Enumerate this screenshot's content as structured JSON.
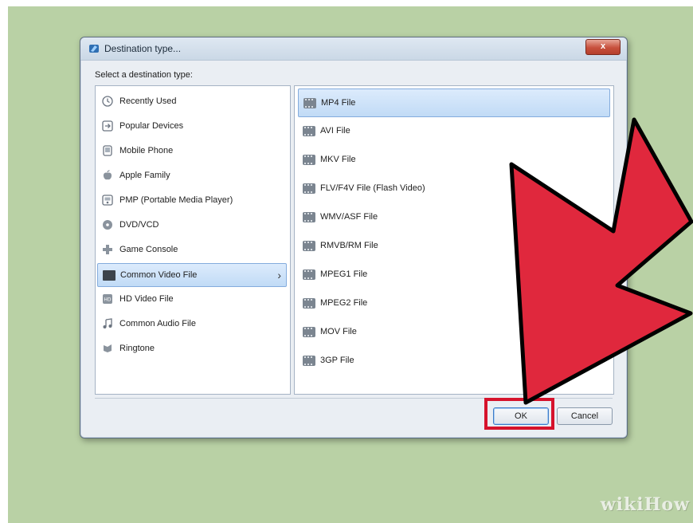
{
  "dialog": {
    "title": "Destination type...",
    "close_glyph": "x",
    "prompt": "Select a destination type:"
  },
  "categories": [
    {
      "label": "Recently Used",
      "icon": "clock-icon"
    },
    {
      "label": "Popular Devices",
      "icon": "arrow-box-icon"
    },
    {
      "label": "Mobile Phone",
      "icon": "phone-icon"
    },
    {
      "label": "Apple Family",
      "icon": "apple-icon"
    },
    {
      "label": "PMP (Portable Media Player)",
      "icon": "media-player-icon"
    },
    {
      "label": "DVD/VCD",
      "icon": "disc-icon"
    },
    {
      "label": "Game Console",
      "icon": "gamepad-icon"
    },
    {
      "label": "Common Video File",
      "icon": "film-icon",
      "selected": true
    },
    {
      "label": "HD Video File",
      "icon": "hd-icon"
    },
    {
      "label": "Common Audio File",
      "icon": "music-note-icon"
    },
    {
      "label": "Ringtone",
      "icon": "ringtone-icon"
    }
  ],
  "formats": [
    {
      "label": "MP4 File",
      "selected": true
    },
    {
      "label": "AVI File"
    },
    {
      "label": "MKV File"
    },
    {
      "label": "FLV/F4V File (Flash Video)"
    },
    {
      "label": "WMV/ASF File"
    },
    {
      "label": "RMVB/RM File"
    },
    {
      "label": "MPEG1 File"
    },
    {
      "label": "MPEG2 File"
    },
    {
      "label": "MOV File"
    },
    {
      "label": "3GP File"
    }
  ],
  "buttons": {
    "ok": "OK",
    "cancel": "Cancel"
  },
  "watermark": "wikiHow",
  "colors": {
    "background": "#b9d1a5",
    "arrow": "#e0283d",
    "highlight": "#d6132c",
    "selection": "#c1dbf6"
  }
}
